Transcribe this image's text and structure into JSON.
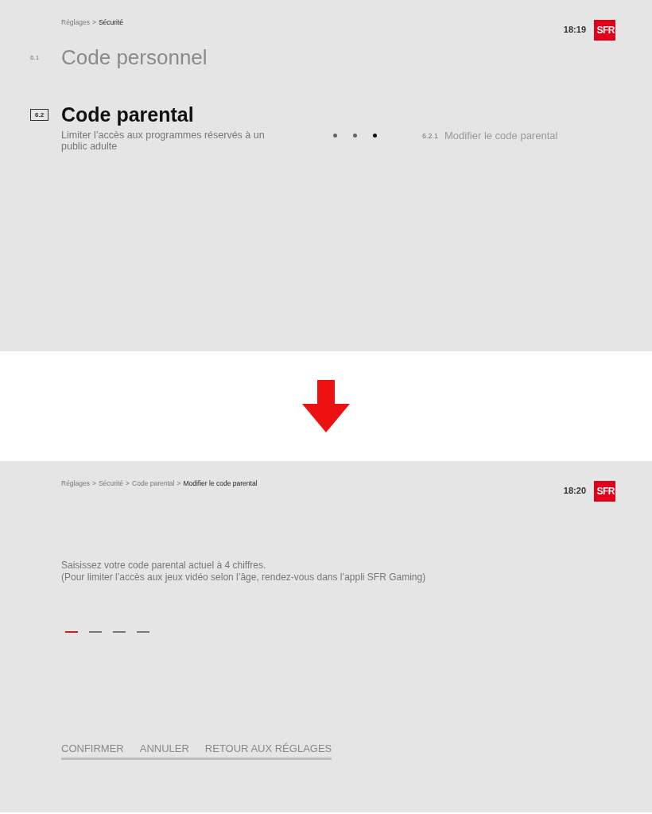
{
  "screens": [
    {
      "breadcrumb_separator": ">",
      "breadcrumb": [
        {
          "label": "Réglages",
          "selected": false
        },
        {
          "label": "Sécurité",
          "selected": true
        }
      ],
      "time": "18:19",
      "logo": "SFR",
      "kind": "menu",
      "items": [
        {
          "number": "6.1",
          "title": "Code personnel",
          "selected": false
        },
        {
          "number": "6.2",
          "title": "Code parental",
          "selected": true,
          "description": "Limiter l’accès aux programmes réservés à un public adulte"
        }
      ],
      "dots": [
        {
          "selected": false
        },
        {
          "selected": false
        },
        {
          "selected": true
        }
      ],
      "submenu": {
        "number": "6.2.1",
        "label": "Modifier le code parental"
      }
    },
    {
      "breadcrumb_separator": ">",
      "breadcrumb": [
        {
          "label": "Réglages",
          "selected": false
        },
        {
          "label": "Sécurité",
          "selected": false
        },
        {
          "label": "Code parental",
          "selected": false
        },
        {
          "label": "Modifier le code parental",
          "selected": true
        }
      ],
      "time": "18:20",
      "logo": "SFR",
      "kind": "pin",
      "instructions": [
        "Saisissez votre code parental actuel à 4 chiffres.",
        "(Pour limiter l’accès aux jeux vidéo selon l’âge, rendez-vous dans l’appli SFR Gaming)"
      ],
      "pin_slots": [
        {
          "selected": true
        },
        {
          "selected": false
        },
        {
          "selected": false
        },
        {
          "selected": false
        }
      ],
      "actions": [
        "CONFIRMER",
        "ANNULER",
        "RETOUR AUX RÉGLAGES"
      ]
    }
  ]
}
